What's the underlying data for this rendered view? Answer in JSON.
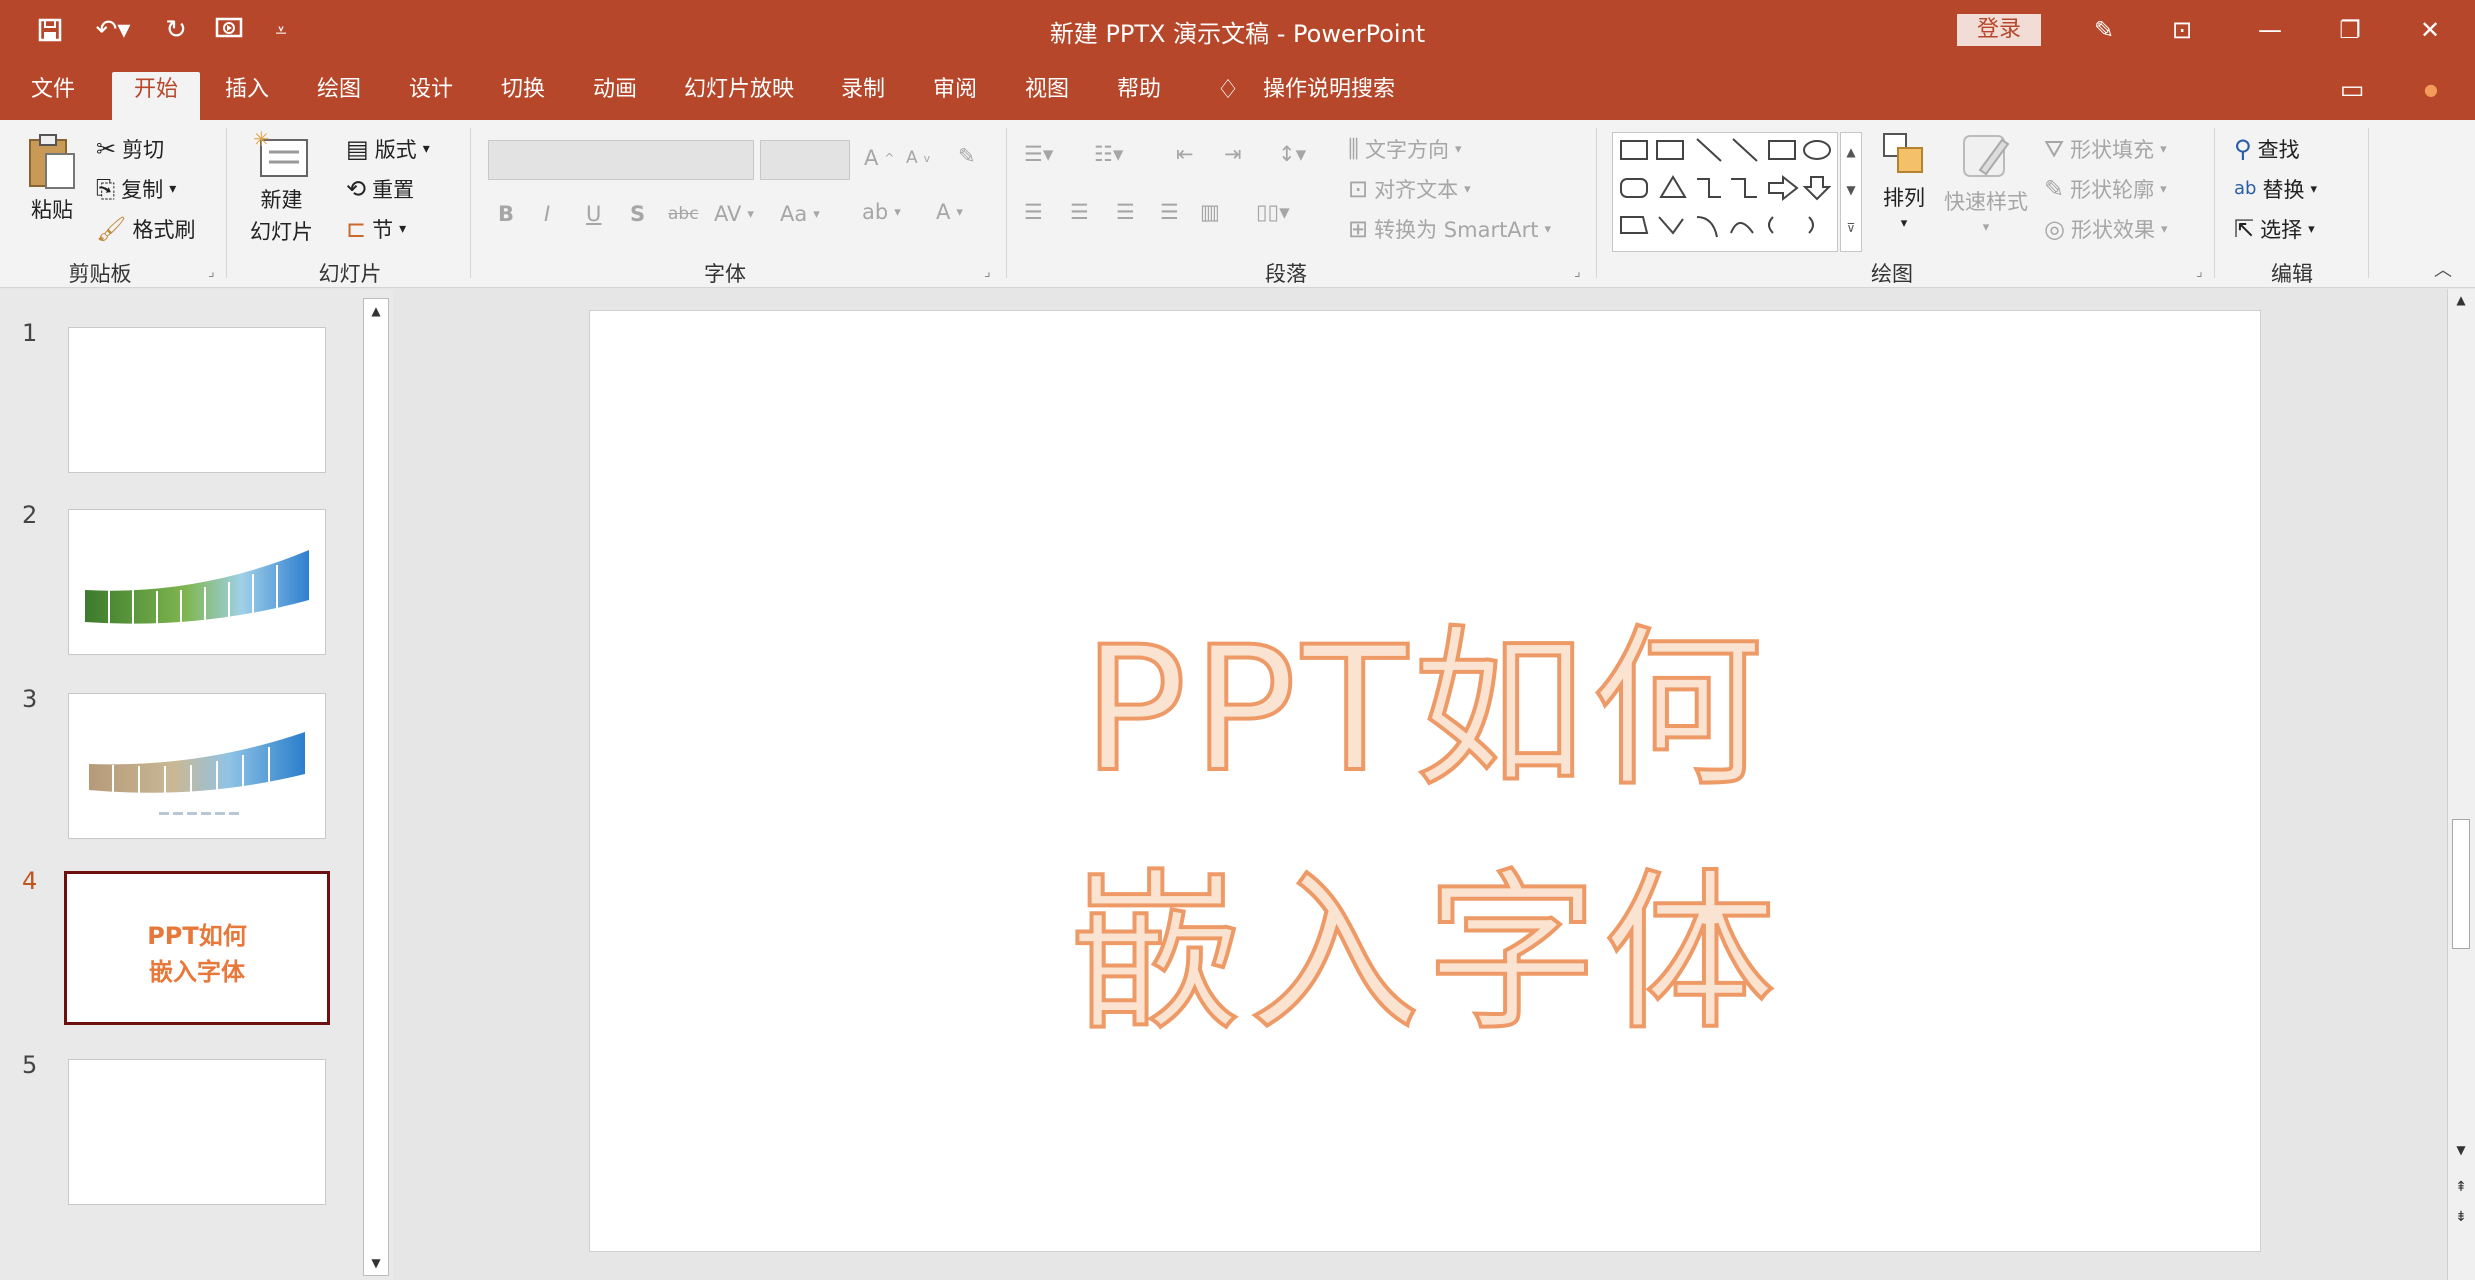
{
  "titlebar": {
    "title": "新建 PPTX 演示文稿 - PowerPoint",
    "login": "登录",
    "quick_access_icons": [
      "save-icon",
      "undo-icon",
      "redo-icon",
      "present-icon",
      "customize-icon"
    ],
    "window_icons": [
      "wand-icon",
      "ribbon-display-icon",
      "minimize-icon",
      "restore-icon",
      "close-icon"
    ]
  },
  "tabs": [
    "文件",
    "开始",
    "插入",
    "绘图",
    "设计",
    "切换",
    "动画",
    "幻灯片放映",
    "录制",
    "审阅",
    "视图",
    "帮助"
  ],
  "active_tab": "开始",
  "tell_me": "操作说明搜索",
  "ribbon": {
    "clipboard": {
      "paste": "粘贴",
      "cut": "剪切",
      "copy": "复制",
      "format_painter": "格式刷",
      "label": "剪贴板"
    },
    "slides": {
      "new_slide_1": "新建",
      "new_slide_2": "幻灯片",
      "layout": "版式",
      "reset": "重置",
      "section": "节",
      "label": "幻灯片"
    },
    "font": {
      "label": "字体",
      "bold": "B",
      "italic": "I",
      "underline": "U",
      "strike": "S",
      "abc": "abc",
      "spacing": "AV",
      "case": "Aa",
      "grow": "A",
      "shrink": "A",
      "color": "A"
    },
    "paragraph": {
      "label": "段落",
      "text_direction": "文字方向",
      "align_text": "对齐文本",
      "smartart": "转换为 SmartArt"
    },
    "drawing": {
      "label": "绘图",
      "arrange": "排列",
      "quick_styles": "快速样式",
      "fill": "形状填充",
      "outline": "形状轮廓",
      "effects": "形状效果"
    },
    "editing": {
      "label": "编辑",
      "find": "查找",
      "replace": "替换",
      "select": "选择"
    }
  },
  "slides": [
    {
      "num": "1",
      "type": "blank"
    },
    {
      "num": "2",
      "type": "photo-strip"
    },
    {
      "num": "3",
      "type": "photo-strip-caption"
    },
    {
      "num": "4",
      "type": "text",
      "line1": "PPT如何",
      "line2": "嵌入字体",
      "selected": true
    },
    {
      "num": "5",
      "type": "blank"
    }
  ],
  "current_slide": {
    "line1": "PPT如何",
    "line2": "嵌入字体"
  },
  "colors": {
    "accent": "#b7472a",
    "text_fill": "#fbe3d2",
    "text_outline": "#ee9a66",
    "thumb_text": "#e8783a"
  }
}
